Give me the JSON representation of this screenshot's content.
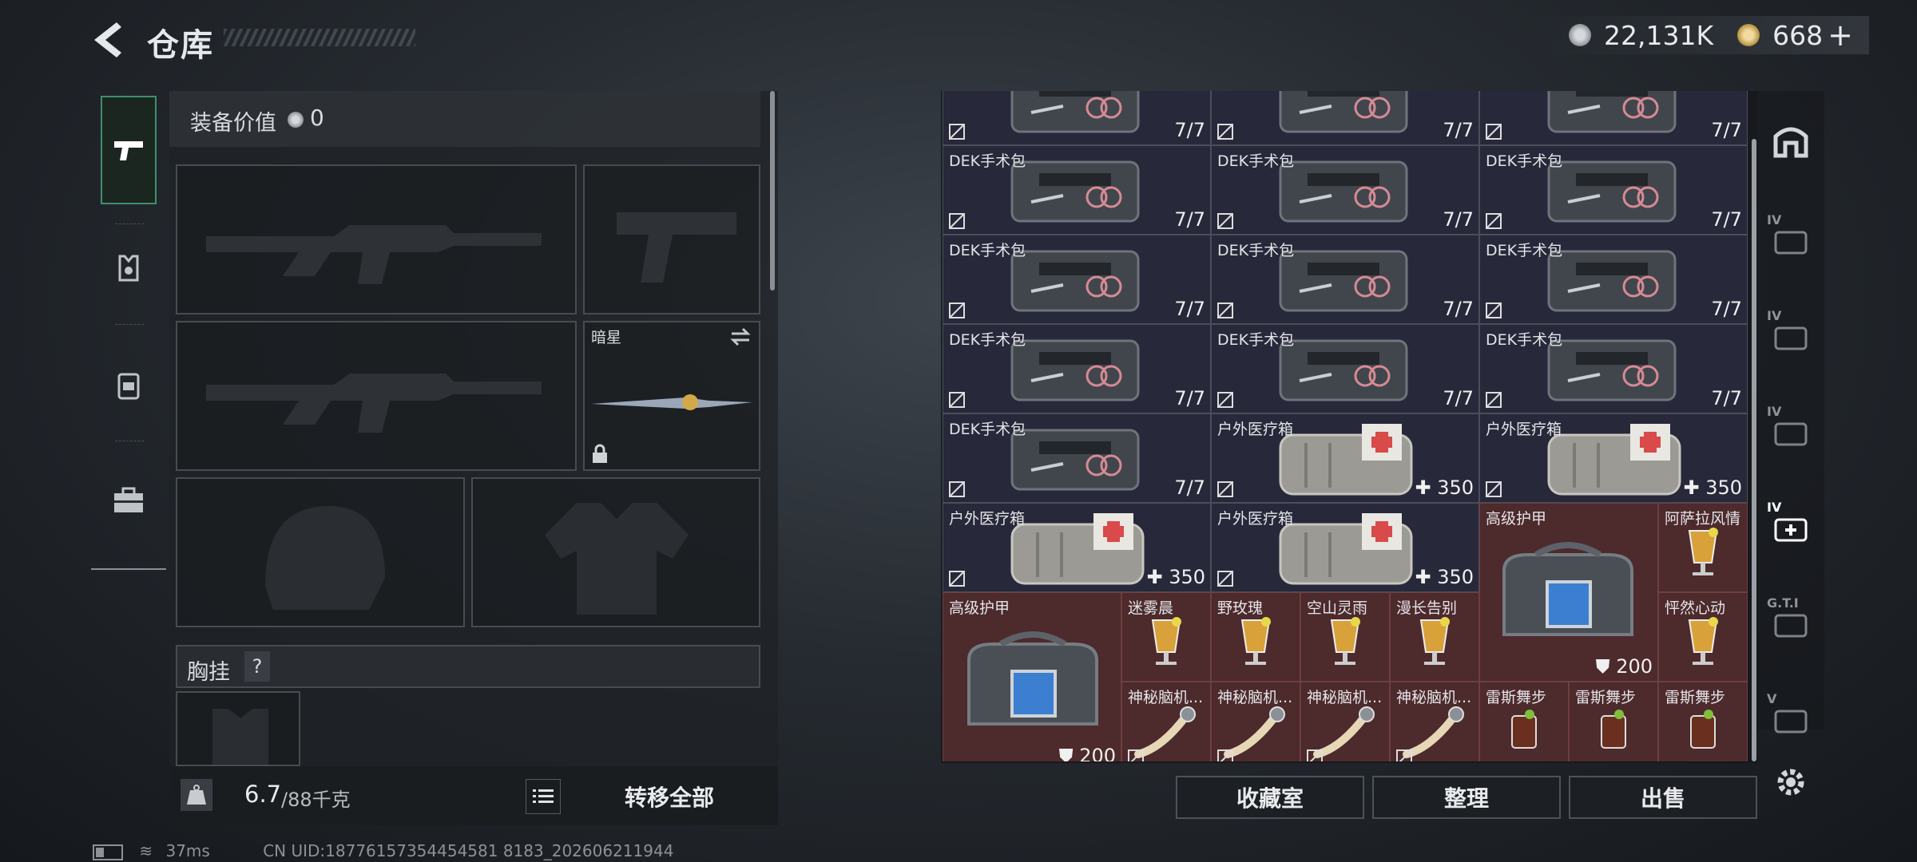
{
  "header": {
    "title": "仓库",
    "currency_value": "22,131K",
    "premium_value": "668",
    "premium_plus": "+"
  },
  "equip": {
    "value_label": "装备价值",
    "value": "0",
    "melee_name": "暗星",
    "chest_label": "胸挂",
    "chest_help": "?",
    "weight_current": "6.7",
    "weight_max": "/88千克",
    "transfer_all": "转移全部"
  },
  "inventory": {
    "rows": [
      {
        "cells": [
          {
            "name": "",
            "count": "7/7",
            "type": "medkit"
          },
          {
            "name": "",
            "count": "7/7",
            "type": "medkit"
          },
          {
            "name": "",
            "count": "7/7",
            "type": "medkit"
          }
        ]
      },
      {
        "cells": [
          {
            "name": "DEK手术包",
            "count": "7/7",
            "type": "medkit"
          },
          {
            "name": "DEK手术包",
            "count": "7/7",
            "type": "medkit"
          },
          {
            "name": "DEK手术包",
            "count": "7/7",
            "type": "medkit"
          }
        ]
      },
      {
        "cells": [
          {
            "name": "DEK手术包",
            "count": "7/7",
            "type": "medkit"
          },
          {
            "name": "DEK手术包",
            "count": "7/7",
            "type": "medkit"
          },
          {
            "name": "DEK手术包",
            "count": "7/7",
            "type": "medkit"
          }
        ]
      },
      {
        "cells": [
          {
            "name": "DEK手术包",
            "count": "7/7",
            "type": "medkit"
          },
          {
            "name": "DEK手术包",
            "count": "7/7",
            "type": "medkit"
          },
          {
            "name": "DEK手术包",
            "count": "7/7",
            "type": "medkit"
          }
        ]
      },
      {
        "cells": [
          {
            "name": "DEK手术包",
            "count": "7/7",
            "type": "medkit"
          },
          {
            "name": "户外医疗箱",
            "count": "350",
            "type": "outdoor"
          },
          {
            "name": "户外医疗箱",
            "count": "350",
            "type": "outdoor"
          }
        ]
      },
      {
        "cells": [
          {
            "name": "户外医疗箱",
            "count": "350",
            "type": "outdoor"
          },
          {
            "name": "户外医疗箱",
            "count": "350",
            "type": "outdoor"
          }
        ]
      }
    ],
    "armor_a": {
      "name": "高级护甲",
      "count": "200"
    },
    "armor_b": {
      "name": "高级护甲",
      "count": "200"
    },
    "drink_a": "阿萨拉风情",
    "drink_b": "怦然心动",
    "drinks_row": [
      "迷雾晨",
      "野玫瑰",
      "空山灵雨",
      "漫长告别"
    ],
    "brain_items": [
      "神秘脑机...",
      "神秘脑机...",
      "神秘脑机...",
      "神秘脑机..."
    ],
    "dance_items": [
      "雷斯舞步",
      "雷斯舞步",
      "雷斯舞步"
    ]
  },
  "buttons": {
    "collection": "收藏室",
    "sort": "整理",
    "sell": "出售"
  },
  "categories": [
    "IV",
    "IV",
    "IV",
    "IV",
    "G.T.I",
    "V"
  ],
  "status": {
    "ping": "37ms",
    "uid": "CN UID:18776157354454581 8183_202606211944"
  },
  "colors": {
    "accent_green": "#3f8f6a",
    "red_cell": "#4d2a2c",
    "dark_cell": "#27283a"
  }
}
